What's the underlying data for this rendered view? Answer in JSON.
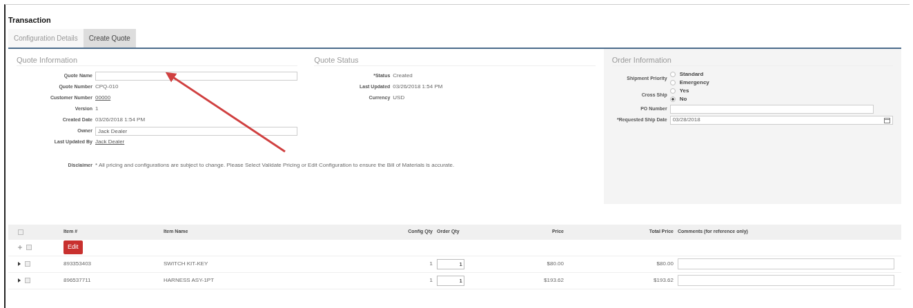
{
  "title": "Transaction",
  "tabs": [
    {
      "label": "Configuration Details",
      "selected": false
    },
    {
      "label": "Create Quote",
      "selected": true
    }
  ],
  "sections": [
    {
      "heading": "Quote Information",
      "kind": "plain",
      "fields": [
        {
          "label": "Quote Name",
          "kind": "input"
        },
        {
          "label": "Quote Number",
          "kind": "text",
          "value": "CPQ-010"
        },
        {
          "label": "Customer Number",
          "kind": "link",
          "value": "00000"
        },
        {
          "label": "Version",
          "kind": "text",
          "value": "1"
        },
        {
          "label": "Created Date",
          "kind": "text",
          "value": "03/26/2018 1:54 PM"
        },
        {
          "label": "Owner",
          "kind": "input",
          "value": "Jack Dealer"
        },
        {
          "label": "Last Updated By",
          "kind": "link",
          "value": "Jack Dealer"
        },
        {
          "label": "Disclaimer",
          "kind": "note",
          "value": "* All pricing and configurations are subject to change. Please Select Validate Pricing or Edit Configuration to ensure the Bill of Materials is accurate."
        }
      ]
    },
    {
      "heading": "Quote Status",
      "kind": "plain",
      "fields": [
        {
          "label": "*Status",
          "kind": "text",
          "value": "Created"
        },
        {
          "label": "Last Updated",
          "kind": "text",
          "value": "03/26/2018 1:54 PM"
        },
        {
          "label": "Currency",
          "kind": "text",
          "value": "USD"
        }
      ]
    },
    {
      "heading": "Order Information",
      "kind": "panel",
      "fields": [
        {
          "label": "Shipment Priority",
          "kind": "radio",
          "options": [
            {
              "label": "Standard",
              "selected": false
            },
            {
              "label": "Emergency",
              "selected": false
            }
          ]
        },
        {
          "label": "Cross Ship",
          "kind": "radio",
          "options": [
            {
              "label": "Yes",
              "selected": false
            },
            {
              "label": "No",
              "selected": true
            }
          ]
        },
        {
          "label": "PO Number",
          "kind": "input"
        },
        {
          "label": "*Requested Ship Date",
          "kind": "date",
          "value": "03/28/2018"
        }
      ]
    }
  ],
  "table": {
    "columns": [
      "Item #",
      "Item Name",
      "Config Qty",
      "Order Qty",
      "Price",
      "Total Price",
      "Comments (for reference only)"
    ],
    "header_checked": false,
    "edit_row": {
      "checked": false,
      "button": "Edit"
    },
    "rows": [
      {
        "checked": false,
        "item_no": "893353403",
        "item_name": "SWITCH KIT-KEY",
        "config_qty": "1",
        "order_qty": "1",
        "price": "$80.00",
        "total_price": "$80.00"
      },
      {
        "checked": false,
        "item_no": "896537711",
        "item_name": "HARNESS ASY-1PT",
        "config_qty": "1",
        "order_qty": "1",
        "price": "$193.62",
        "total_price": "$193.62"
      }
    ]
  }
}
